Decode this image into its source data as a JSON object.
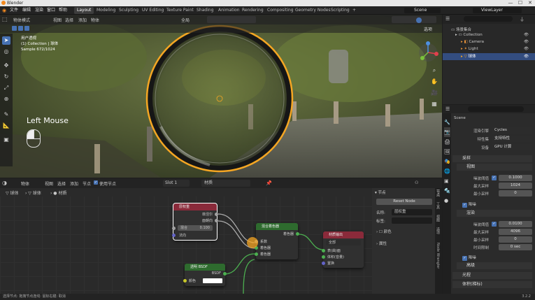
{
  "window": {
    "title": "Blender",
    "controls": [
      "—",
      "☐",
      "✕"
    ]
  },
  "menu": [
    "文件",
    "编辑",
    "渲染",
    "窗口",
    "帮助"
  ],
  "workspaces": [
    {
      "label": "Layout",
      "active": true
    },
    {
      "label": "Modeling",
      "active": false
    },
    {
      "label": "Sculpting",
      "active": false
    },
    {
      "label": "UV Editing",
      "active": false
    },
    {
      "label": "Texture Paint",
      "active": false
    },
    {
      "label": "Shading",
      "active": false
    },
    {
      "label": "Animation",
      "active": false
    },
    {
      "label": "Rendering",
      "active": false
    },
    {
      "label": "Compositing",
      "active": false
    },
    {
      "label": "Geometry Nodes",
      "active": false
    },
    {
      "label": "Scripting",
      "active": false
    }
  ],
  "scene": {
    "name": "Scene",
    "viewlayer": "ViewLayer"
  },
  "viewport": {
    "mode": "物体模式",
    "menus": [
      "视图",
      "选择",
      "添加",
      "物体"
    ],
    "transform": "全局",
    "options_label": "选项",
    "overlay_lines": [
      "用户透视",
      "(1) Collection | 球体",
      "Sample 672/1024"
    ],
    "key_label": "Left Mouse"
  },
  "outliner": {
    "title": "场景集合",
    "items": [
      {
        "label": "Collection",
        "icon": "collection-icon",
        "selected": false
      },
      {
        "label": "Camera",
        "icon": "camera-icon",
        "selected": false
      },
      {
        "label": "Light",
        "icon": "light-icon",
        "selected": false
      },
      {
        "label": "球体",
        "icon": "mesh-icon",
        "selected": true
      }
    ]
  },
  "properties": {
    "scene_label": "Scene",
    "rows": [
      {
        "label": "渲染引擎",
        "value": "Cycles"
      },
      {
        "label": "特性集",
        "value": "支持特性"
      },
      {
        "label": "设备",
        "value": "GPU 计算"
      }
    ],
    "sampling_title": "采样",
    "viewport_title": "视图",
    "viewport_rows": [
      {
        "label": "噪波阈值",
        "value": "0.1000",
        "checkbox": true
      },
      {
        "label": "最大采样",
        "value": "1024"
      },
      {
        "label": "最小采样",
        "value": "0"
      }
    ],
    "denoise_label": "降噪",
    "render_title": "渲染",
    "render_rows": [
      {
        "label": "噪波阈值",
        "value": "0.0100",
        "checkbox": true
      },
      {
        "label": "最大采样",
        "value": "4096"
      },
      {
        "label": "最小采样",
        "value": "0"
      },
      {
        "label": "时间限制",
        "value": "0 sec"
      }
    ],
    "denoise2_label": "降噪",
    "extra_sections": [
      "高级",
      "光程",
      "体积(梯标)"
    ],
    "version": "3.2.2"
  },
  "node_editor": {
    "type_label": "物体",
    "menus": [
      "视图",
      "选择",
      "添加",
      "节点"
    ],
    "use_nodes_label": "使用节点",
    "slot": "Slot 1",
    "material": "材质",
    "breadcrumb": [
      "球体",
      "球体",
      "材质"
    ],
    "sidepanel": {
      "section": "节点",
      "reset_button": "Reset Node",
      "name_label": "名称:",
      "name_value": "层权重",
      "label_label": "标签:",
      "color_label": "颜色",
      "props_label": "属性"
    },
    "tabs": [
      "节点",
      "工具",
      "视图",
      "选项",
      "Node Wrangler"
    ],
    "nodes": {
      "layer_weight": {
        "title": "层权重",
        "outputs": [
          "菲涅尔",
          "面朝向"
        ],
        "blend_label": "混合",
        "blend_value": "0.100",
        "normal_label": "法向"
      },
      "mix_shader": {
        "title": "混合着色器",
        "output": "着色器",
        "inputs": [
          "系数",
          "着色器",
          "着色器"
        ]
      },
      "material_output": {
        "title": "材质输出",
        "target": "全部",
        "inputs": [
          "表(曲)面",
          "体积(音量)",
          "置换"
        ]
      },
      "transparent_bsdf": {
        "title": "透明 BSDF",
        "output": "BSDF",
        "color_label": "颜色"
      }
    }
  },
  "status": {
    "text": "选择节点: 拖拽节点连线: 鼠标右键: 取消",
    "version": "3.2.2"
  },
  "colors": {
    "accent": "#4772b3",
    "selection": "#f5a623",
    "layer_weight_header": "#8a2a3a",
    "mix_header": "#2e6b2e",
    "output_header": "#8a2a3a",
    "bsdf_header": "#2e6b2e"
  }
}
